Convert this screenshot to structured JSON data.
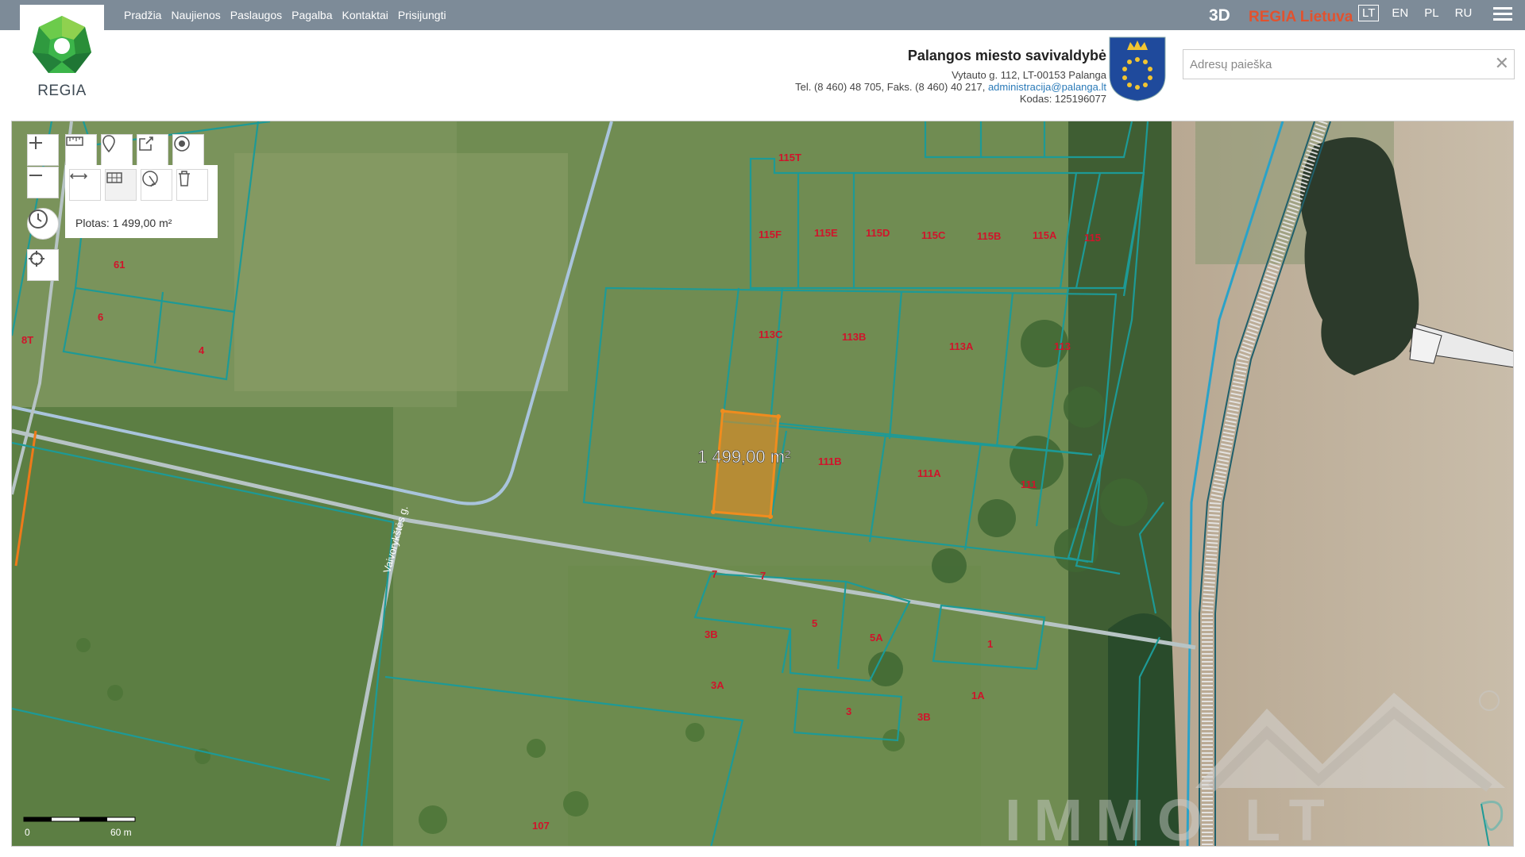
{
  "nav": {
    "items": [
      "Pradžia",
      "Naujienos",
      "Paslaugos",
      "Pagalba",
      "Kontaktai",
      "Prisijungti"
    ]
  },
  "topbar": {
    "mode_3d": "3D",
    "brand": "REGIA Lietuva",
    "languages": [
      "LT",
      "EN",
      "PL",
      "RU"
    ],
    "active_language": "LT"
  },
  "logo": {
    "text": "REGIA"
  },
  "municipality": {
    "name": "Palangos miesto savivaldybė",
    "address": "Vytauto g. 112, LT-00153 Palanga",
    "contacts_prefix": "Tel. (8 460) 48 705, Faks. (8 460) 40 217, ",
    "email": "administracija@palanga.lt",
    "code": "Kodas: 125196077"
  },
  "search": {
    "placeholder": "Adresų paieška",
    "value": ""
  },
  "measure": {
    "area_label": "Plotas: 1 499,00 m²",
    "map_label": "1 499,00 m²"
  },
  "map": {
    "street_label": "Vaivorykštės g.",
    "scale_start": "0",
    "scale_end": "60 m",
    "parcel_labels": [
      "115T",
      "115F",
      "115E",
      "115D",
      "115C",
      "115B",
      "115A",
      "115",
      "113C",
      "113B",
      "113A",
      "113",
      "111B",
      "111A",
      "111",
      "61",
      "6",
      "4",
      "8T",
      "7",
      "5",
      "5A",
      "1",
      "3B",
      "3A",
      "3",
      "1A",
      "107"
    ],
    "watermark": "IMMO LT"
  },
  "colors": {
    "topbar": "#7d8b98",
    "parcel_outline": "#1d9a96",
    "parcel_label": "#d0142b",
    "selection": "#f08c1e",
    "brand": "#e2522e"
  }
}
